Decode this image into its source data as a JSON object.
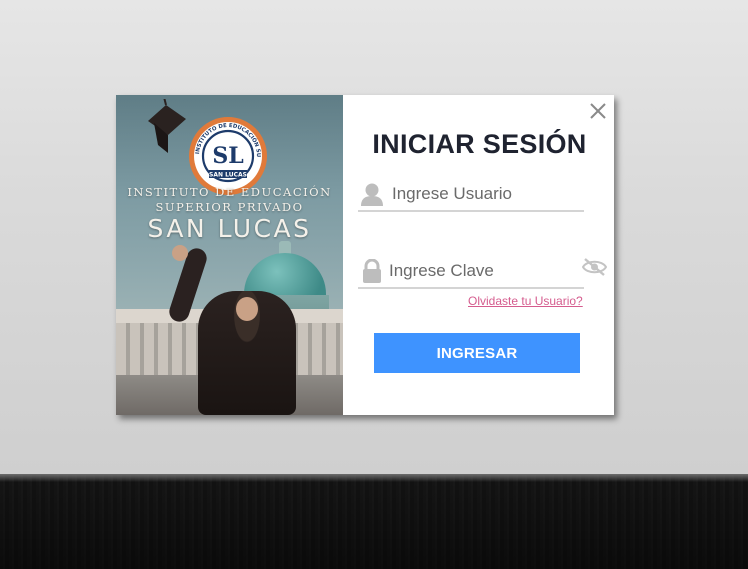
{
  "background": {
    "sky_color": "#d8d8d8",
    "ground_color": "#3f3f3f"
  },
  "promo": {
    "institute_line1": "INSTITUTO DE EDUCACIÓN",
    "institute_line2": "SUPERIOR PRIVADO",
    "institute_name": "SAN LUCAS",
    "logo_ring_text": "INSTITUTO DE EDUCACIÓN SUPERIOR PRIVADO",
    "logo_initials": "SL",
    "logo_banner": "SAN LUCAS",
    "logo_color": "#e07a3a"
  },
  "login": {
    "title": "INICIAR SESIÓN",
    "username_placeholder": "Ingrese Usuario",
    "password_placeholder": "Ingrese Clave",
    "forgot_link": "Olvidaste tu Usuario?",
    "submit_label": "INGRESAR",
    "accent_color": "#3e93ff",
    "link_color": "#d55c8e",
    "close_icon": "close-icon",
    "user_icon": "user-icon",
    "lock_icon": "lock-icon",
    "eye_icon": "eye-slash-icon"
  }
}
